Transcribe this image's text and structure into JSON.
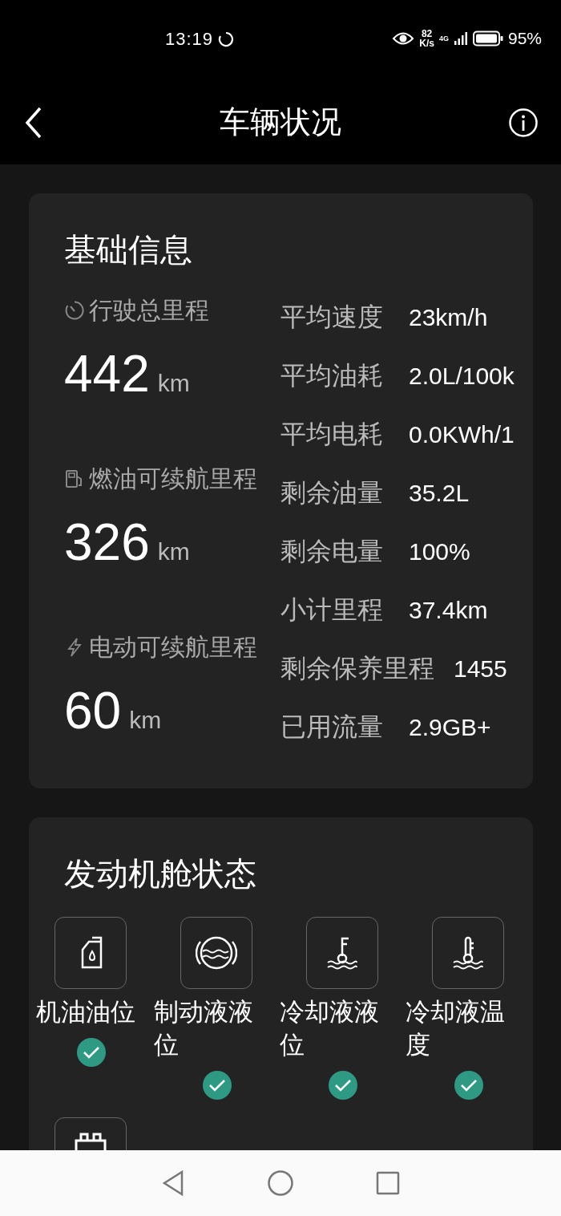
{
  "status_bar": {
    "time": "13:19",
    "net_speed_value": "82",
    "net_speed_unit": "K/s",
    "network": "4G",
    "battery": "95%"
  },
  "header": {
    "title": "车辆状况"
  },
  "basic_info": {
    "title": "基础信息",
    "ranges": [
      {
        "kind": "odometer",
        "label": "行驶总里程",
        "value": "442",
        "unit": "km"
      },
      {
        "kind": "fuel",
        "label": "燃油可续航里程",
        "value": "326",
        "unit": "km"
      },
      {
        "kind": "electric",
        "label": "电动可续航里程",
        "value": "60",
        "unit": "km"
      }
    ],
    "stats": [
      {
        "label": "平均速度",
        "value": "23km/h"
      },
      {
        "label": "平均油耗",
        "value": "2.0L/100k"
      },
      {
        "label": "平均电耗",
        "value": "0.0KWh/1"
      },
      {
        "label": "剩余油量",
        "value": "35.2L"
      },
      {
        "label": "剩余电量",
        "value": "100%"
      },
      {
        "label": "小计里程",
        "value": "37.4km"
      },
      {
        "label": "剩余保养里程",
        "value": "1455"
      },
      {
        "label": "已用流量",
        "value": "2.9GB+"
      }
    ]
  },
  "engine_bay": {
    "title": "发动机舱状态",
    "items": [
      {
        "kind": "oil",
        "label": "机油油位",
        "ok": true
      },
      {
        "kind": "brake",
        "label": "制动液液位",
        "ok": true
      },
      {
        "kind": "coolant_level",
        "label": "冷却液液位",
        "ok": true
      },
      {
        "kind": "coolant_temp",
        "label": "冷却液温度",
        "ok": true
      },
      {
        "kind": "battery"
      }
    ]
  }
}
